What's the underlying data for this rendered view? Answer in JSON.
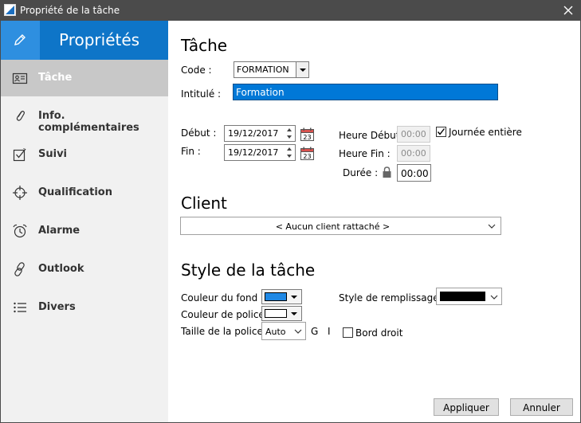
{
  "window": {
    "title": "Propriété de la tâche"
  },
  "sidebar": {
    "header": "Propriétés",
    "items": [
      {
        "label": "Tâche",
        "icon": "contact-card-icon",
        "active": true
      },
      {
        "label": "Info. complémentaires",
        "icon": "paperclip-icon",
        "active": false
      },
      {
        "label": "Suivi",
        "icon": "checkbox-icon",
        "active": false
      },
      {
        "label": "Qualification",
        "icon": "crosshair-icon",
        "active": false
      },
      {
        "label": "Alarme",
        "icon": "alarm-clock-icon",
        "active": false
      },
      {
        "label": "Outlook",
        "icon": "link-icon",
        "active": false
      },
      {
        "label": "Divers",
        "icon": "list-icon",
        "active": false
      }
    ]
  },
  "task": {
    "heading": "Tâche",
    "code_label": "Code :",
    "code_value": "FORMATION",
    "intitule_label": "Intitulé :",
    "intitule_value": "Formation",
    "debut_label": "Début :",
    "debut_value": "19/12/2017",
    "fin_label": "Fin :",
    "fin_value": "19/12/2017",
    "calendar_day": "23",
    "heure_debut_label": "Heure Début :",
    "heure_debut_value": "00:00",
    "heure_fin_label": "Heure Fin :",
    "heure_fin_value": "00:00",
    "duree_label": "Durée :",
    "duree_value": "00:00",
    "journee_label": "Journée entière",
    "journee_checked": true
  },
  "client": {
    "heading": "Client",
    "value": "< Aucun client rattaché >"
  },
  "style": {
    "heading": "Style de la tâche",
    "fond_label": "Couleur du fond :",
    "fond_color": "#1e88e5",
    "police_label": "Couleur de police :",
    "police_color": "#ffffff",
    "taille_label": "Taille de la police",
    "taille_value": "Auto",
    "bold_label": "G",
    "italic_label": "I",
    "remplissage_label": "Style de remplissage :",
    "remplissage_color": "#000000",
    "bord_label": "Bord droit",
    "bord_checked": false
  },
  "buttons": {
    "apply": "Appliquer",
    "cancel": "Annuler"
  },
  "colors": {
    "titlebar": "#4b4b4b",
    "accent": "#0e75c8",
    "selection": "#0078d7"
  }
}
